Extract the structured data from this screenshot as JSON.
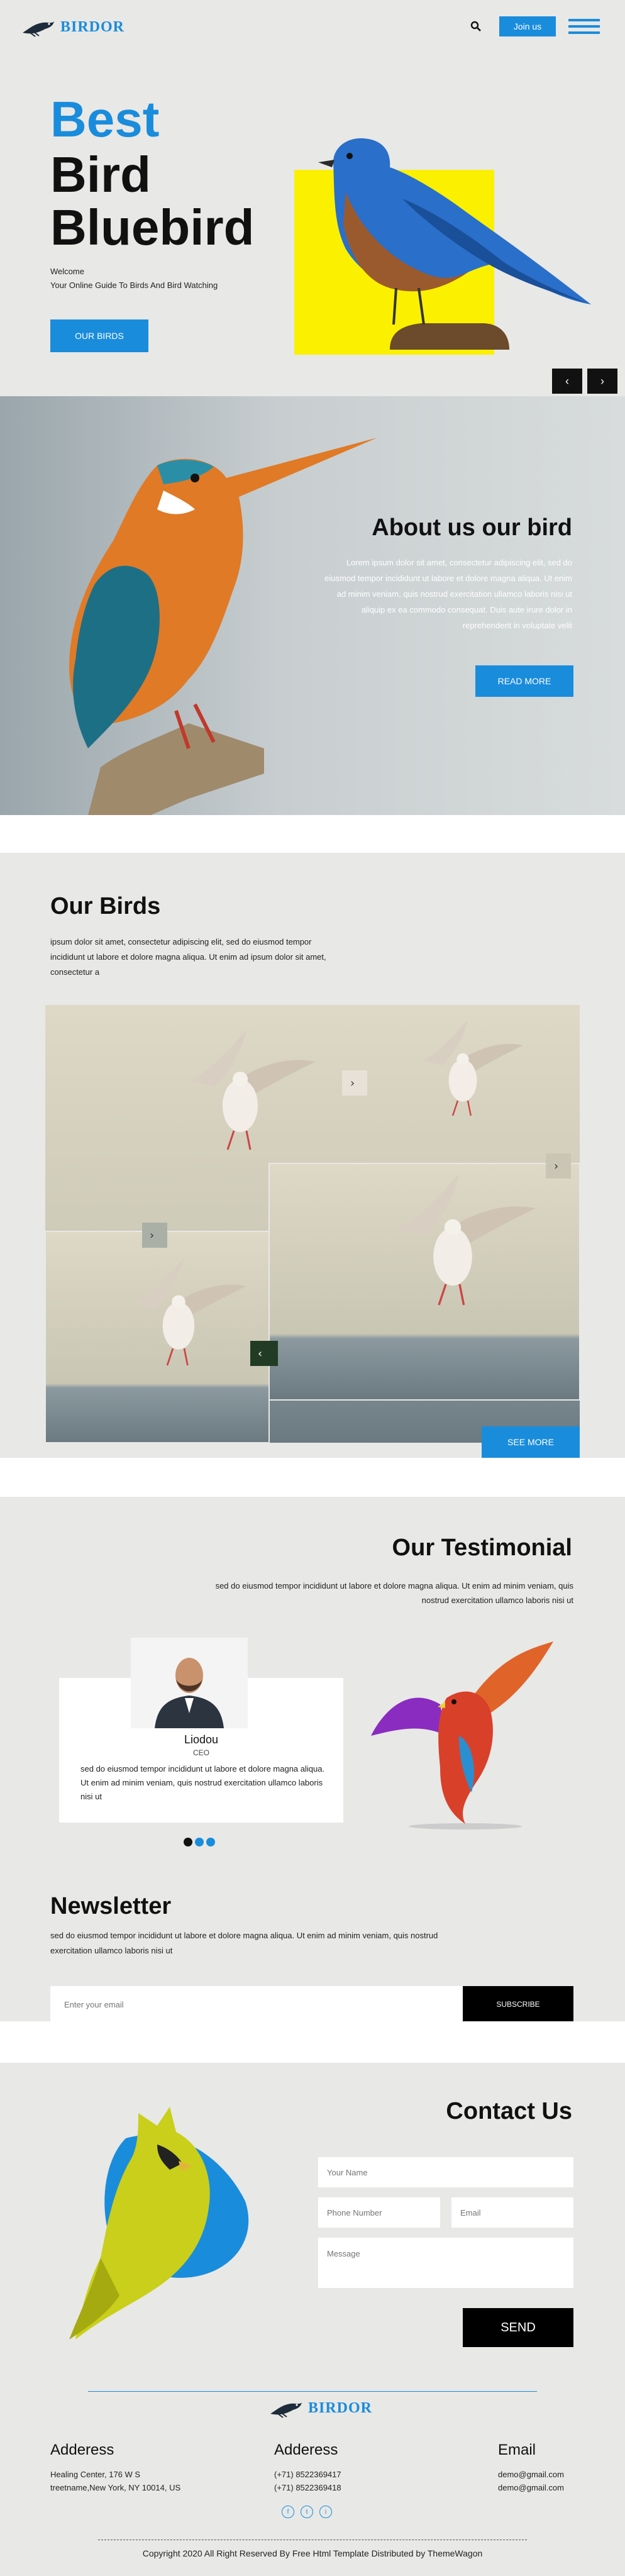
{
  "header": {
    "logo": "BIRDOR",
    "join_label": "Join us"
  },
  "hero": {
    "title_accent": "Best",
    "title_line2": "Bird",
    "title_line3": "Bluebird",
    "welcome": "Welcome",
    "subtitle": "Your Online Guide To Birds And Bird Watching",
    "button": "OUR BIRDS",
    "prev": "‹",
    "next": "›"
  },
  "about": {
    "title": "About us our bird",
    "text": "Lorem ipsum dolor sit amet, consectetur adipiscing elit, sed do eiusmod tempor incididunt ut labore et dolore magna aliqua. Ut enim ad minim veniam, quis nostrud exercitation ullamco laboris nisi ut aliquip ex ea commodo consequat. Duis aute irure dolor in reprehenderit in voluptate velit",
    "button": "READ MORE"
  },
  "birds": {
    "title": "Our Birds",
    "text": "ipsum dolor sit amet, consectetur adipiscing elit, sed do eiusmod tempor incididunt ut labore et dolore magna aliqua. Ut enim ad ipsum dolor sit amet, consectetur a",
    "button": "SEE MORE"
  },
  "testimonial": {
    "title": "Our Testimonial",
    "text": "sed do eiusmod tempor incididunt ut labore et dolore magna aliqua. Ut enim ad minim veniam, quis nostrud exercitation ullamco laboris nisi ut",
    "name": "Liodou",
    "role": "CEO",
    "quote": "sed do eiusmod tempor incididunt ut labore et dolore magna aliqua. Ut enim ad minim veniam, quis nostrud exercitation ullamco laboris nisi ut"
  },
  "newsletter": {
    "title": "Newsletter",
    "text": "sed do eiusmod tempor incididunt ut labore et dolore magna aliqua. Ut enim ad minim veniam, quis nostrud exercitation ullamco laboris nisi ut",
    "placeholder": "Enter your email",
    "button": "SUBSCRIBE"
  },
  "contact": {
    "title": "Contact Us",
    "name_placeholder": "Your Name",
    "phone_placeholder": "Phone Number",
    "email_placeholder": "Email",
    "message_placeholder": "Message",
    "button": "SEND"
  },
  "footer": {
    "logo": "BIRDOR",
    "address_title": "Adderess",
    "address_line1": "Healing Center, 176 W S",
    "address_line2": "treetname,New York, NY 10014, US",
    "phone_title": "Adderess",
    "phone1": "(+71) 8522369417",
    "phone2": "(+71) 8522369418",
    "email_title": "Email",
    "email1": "demo@gmail.com",
    "email2": "demo@gmail.com",
    "social": [
      "f",
      "t",
      "i"
    ],
    "copyright": "Copyright 2020 All Right Reserved By Free Html Template Distributed by ThemeWagon"
  },
  "colors": {
    "accent": "#1a8cdc",
    "yellow": "#fbf000",
    "dark": "#111111"
  }
}
